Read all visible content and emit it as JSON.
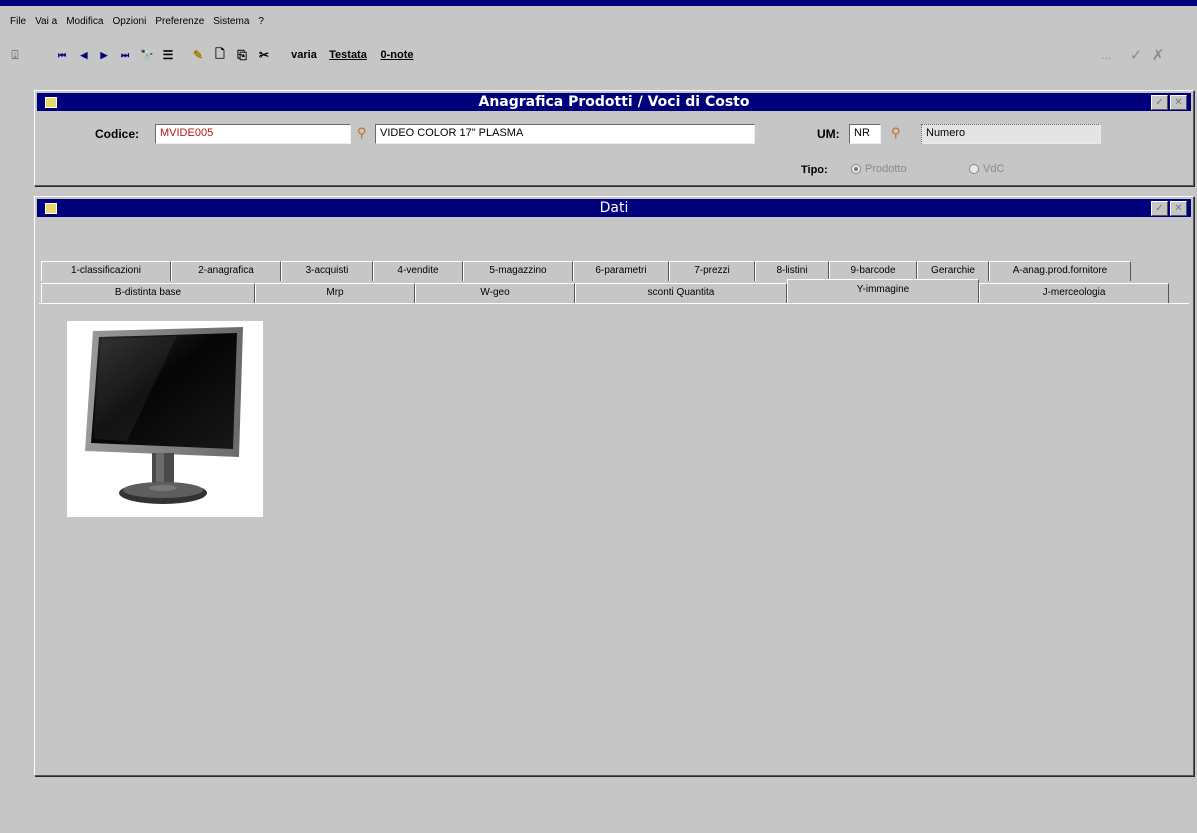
{
  "menu": [
    "File",
    "Vai a",
    "Modifica",
    "Opzioni",
    "Preferenze",
    "Sistema",
    "?"
  ],
  "toolbar": {
    "exit_glyph": "⍗",
    "first_glyph": "⏮",
    "prev_glyph": "◀",
    "next_glyph": "▶",
    "last_glyph": "⏭",
    "search_glyph": "🔭",
    "list_glyph": "☰",
    "edit_glyph": "✎",
    "new_glyph": "🗋",
    "copy_glyph": "⎘",
    "cut_glyph": "✂",
    "varia_label": "varia",
    "testata_label": "Testata",
    "note_label": "0-note",
    "dots_label": "...",
    "confirm_glyph": "✓",
    "cancel_glyph": "✗"
  },
  "anagrafica_window": {
    "title": "Anagrafica Prodotti / Voci di Costo",
    "codice_label": "Codice:",
    "codice_value": "MVIDE005",
    "descrizione_value": "VIDEO COLOR 17\" PLASMA",
    "um_label": "UM:",
    "um_value": "NR",
    "um_desc_value": "Numero",
    "tipo_label": "Tipo:",
    "tipo_options": [
      "Prodotto",
      "VdC"
    ],
    "tipo_selected": "Prodotto"
  },
  "dati_window": {
    "title": "Dati",
    "tabs_row1": [
      "1-classificazioni",
      "2-anagrafica",
      "3-acquisti",
      "4-vendite",
      "5-magazzino",
      "6-parametri",
      "7-prezzi",
      "8-listini",
      "9-barcode",
      "Gerarchie",
      "A-anag.prod.fornitore"
    ],
    "tabs_row2": [
      "B-distinta base",
      "Mrp",
      "W-geo",
      "sconti Quantita",
      "Y-immagine",
      "J-merceologia"
    ],
    "active_tab": "Y-immagine",
    "image_subject": "monitor"
  },
  "colors": {
    "title_bar": "#00007c",
    "background": "#c6c6c6",
    "code_text": "#b01818"
  }
}
